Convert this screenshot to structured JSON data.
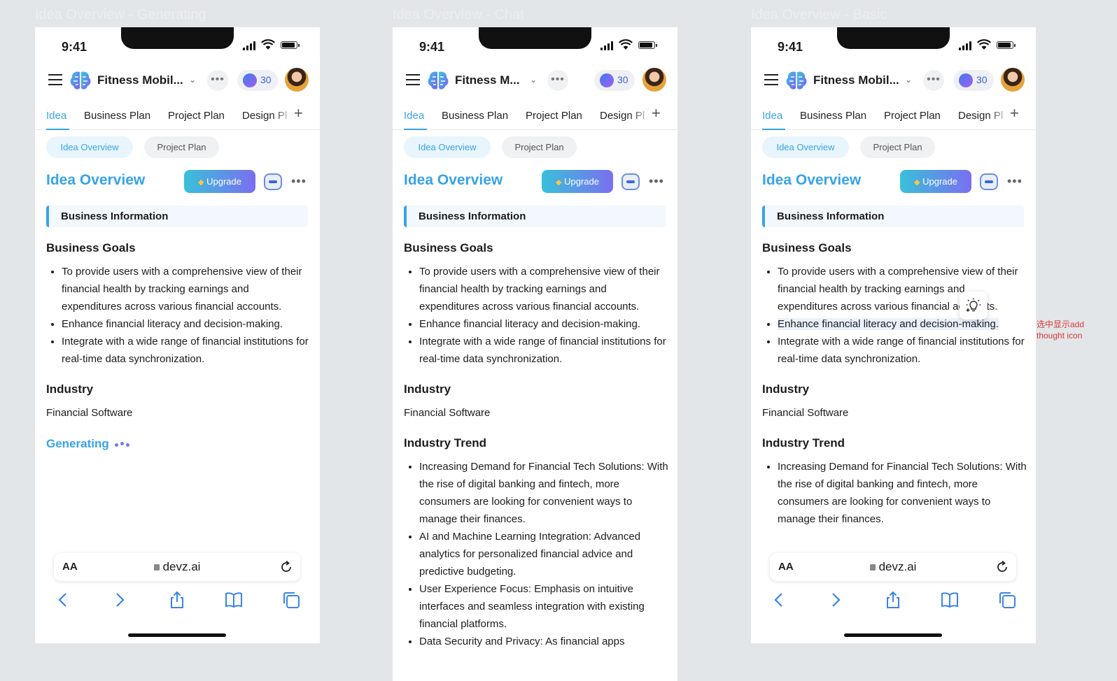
{
  "frames": [
    {
      "title": "Idea Overview - Generating",
      "status_time": "9:41",
      "project_name": "Fitness Mobil...",
      "credits": "30",
      "tabs": [
        "Idea",
        "Business Plan",
        "Project Plan",
        "Design Pl"
      ],
      "chips": [
        "Idea Overview",
        "Project Plan"
      ],
      "page_title": "Idea Overview",
      "upgrade_label": "Upgrade",
      "section_label": "Business Information",
      "goals_heading": "Business Goals",
      "goals": [
        "To provide users with a comprehensive view of their financial health by tracking earnings and expenditures across various financial accounts.",
        "Enhance financial literacy and decision-making.",
        "Integrate with a wide range of financial institutions for real-time data synchronization."
      ],
      "industry_heading": "Industry",
      "industry_value": "Financial Software",
      "generating_label": "Generating",
      "aa_label": "AA",
      "url": "devz.ai"
    },
    {
      "title": "Idea Overview - Chat",
      "status_time": "9:41",
      "project_name": "Fitness M...",
      "credits": "30",
      "tabs": [
        "Idea",
        "Business Plan",
        "Project Plan",
        "Design Pl"
      ],
      "chips": [
        "Idea Overview",
        "Project Plan"
      ],
      "page_title": "Idea Overview",
      "upgrade_label": "Upgrade",
      "section_label": "Business Information",
      "goals_heading": "Business Goals",
      "goals": [
        "To provide users with a comprehensive view of their financial health by tracking earnings and expenditures across various financial accounts.",
        "Enhance financial literacy and decision-making.",
        "Integrate with a wide range of financial institutions for real-time data synchronization."
      ],
      "industry_heading": "Industry",
      "industry_value": "Financial Software",
      "trend_heading": "Industry Trend",
      "trends": [
        "Increasing Demand for Financial Tech Solutions: With the rise of digital banking and fintech, more consumers are looking for convenient ways to manage their finances.",
        "AI and Machine Learning Integration: Advanced analytics for personalized financial advice and predictive budgeting.",
        "User Experience Focus: Emphasis on intuitive interfaces and seamless integration with existing financial platforms.",
        "Data Security and Privacy: As financial apps"
      ]
    },
    {
      "title": "Idea Overview - Basic",
      "status_time": "9:41",
      "project_name": "Fitness Mobil...",
      "credits": "30",
      "tabs": [
        "Idea",
        "Business Plan",
        "Project Plan",
        "Design Pl"
      ],
      "chips": [
        "Idea Overview",
        "Project Plan"
      ],
      "page_title": "Idea Overview",
      "upgrade_label": "Upgrade",
      "section_label": "Business Information",
      "goals_heading": "Business Goals",
      "goals": [
        "To provide users with a comprehensive view of their financial health by tracking earnings and expenditures across various financial accounts.",
        "Enhance financial literacy and decision-making.",
        "Integrate with a wide range of financial institutions for real-time data synchronization."
      ],
      "industry_heading": "Industry",
      "industry_value": "Financial Software",
      "trend_heading": "Industry Trend",
      "trends": [
        "Increasing Demand for Financial Tech Solutions: With the rise of digital banking and fintech, more consumers are looking for convenient ways to manage their finances."
      ],
      "aa_label": "AA",
      "url": "devz.ai"
    }
  ],
  "annotation_note": "选中显示add thought icon",
  "colors": {
    "accent": "#37a3e8",
    "note": "#d63a3a",
    "upgrade_from": "#39c0da",
    "upgrade_to": "#7a6ff0",
    "canvas": "#e3e6e8"
  },
  "icons": [
    "menu-icon",
    "logo-brain-icon",
    "chevron-down-icon",
    "more-icon",
    "coin-icon",
    "avatar",
    "plus-icon",
    "gem-icon",
    "bot-icon",
    "lightbulb-add-icon",
    "lock-icon",
    "reload-icon",
    "back-icon",
    "forward-icon",
    "share-icon",
    "bookmarks-icon",
    "tabs-icon"
  ]
}
